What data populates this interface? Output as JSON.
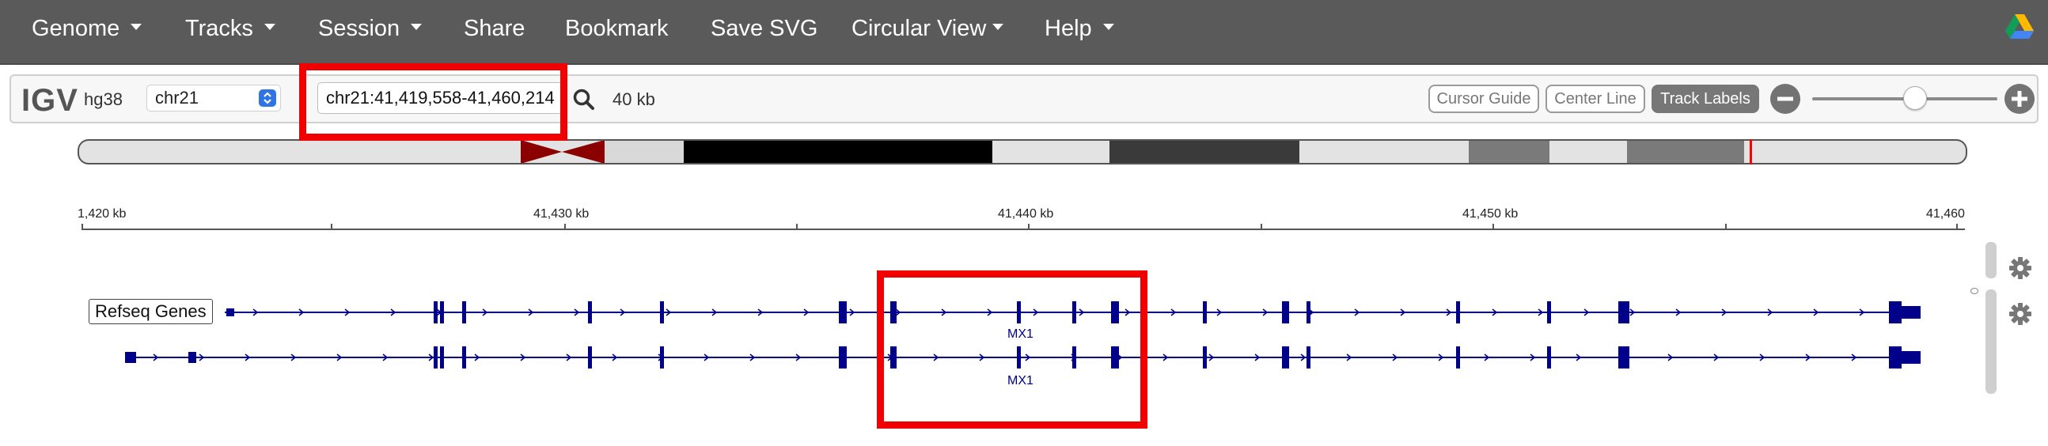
{
  "menu": {
    "items": [
      "Genome",
      "Tracks",
      "Session",
      "Share",
      "Bookmark",
      "Save SVG",
      "Circular View",
      "Help"
    ]
  },
  "navbar": {
    "logo": "IGV",
    "genome": "hg38",
    "chromosome": "chr21",
    "locus": "chr21:41,419,558-41,460,214",
    "window_size": "40 kb",
    "buttons": {
      "cursor_guide": "Cursor Guide",
      "center_line": "Center Line",
      "track_labels": "Track Labels"
    },
    "zoom_level": 0.55
  },
  "ruler": {
    "labels": [
      "1,420 kb",
      "41,430 kb",
      "41,440 kb",
      "41,450 kb",
      "41,460"
    ]
  },
  "track": {
    "label": "Refseq Genes",
    "gene_names": [
      "MX1",
      "MX1"
    ]
  },
  "colors": {
    "menu_bar": "#5a5a5a",
    "gene_feature": "#00008b",
    "highlight": "#f00000",
    "centromere": "#8b0000",
    "active_button": "#777777"
  },
  "icons": {
    "search": "search-icon",
    "zoom_out": "minus-circle-icon",
    "zoom_in": "plus-circle-icon",
    "settings": "gear-icon",
    "google_drive": "google-drive-icon",
    "select_arrows": "chevron-updown-icon"
  }
}
